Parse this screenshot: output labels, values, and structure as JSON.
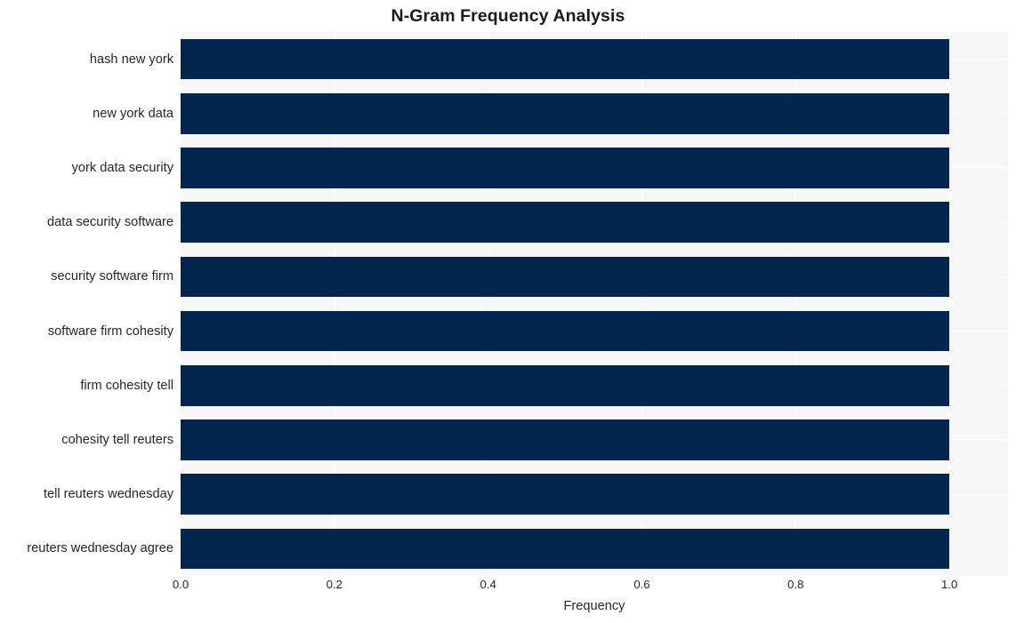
{
  "chart_data": {
    "type": "bar",
    "orientation": "horizontal",
    "title": "N-Gram Frequency Analysis",
    "xlabel": "Frequency",
    "ylabel": "",
    "categories": [
      "hash new york",
      "new york data",
      "york data security",
      "data security software",
      "security software firm",
      "software firm cohesity",
      "firm cohesity tell",
      "cohesity tell reuters",
      "tell reuters wednesday",
      "reuters wednesday agree"
    ],
    "values": [
      1.0,
      1.0,
      1.0,
      1.0,
      1.0,
      1.0,
      1.0,
      1.0,
      1.0,
      1.0
    ],
    "xlim": [
      0.0,
      1.0762
    ],
    "xticks": [
      0.0,
      0.2,
      0.4,
      0.6,
      0.8,
      1.0
    ],
    "xtick_labels": [
      "0.0",
      "0.2",
      "0.4",
      "0.6",
      "0.8",
      "1.0"
    ],
    "grid": true,
    "grid_color": "#ffffff",
    "legend": null,
    "bar_color": "#04254e",
    "plot_background": "#f7f7f7",
    "figure_background": "#ffffff",
    "text_color": "#262626"
  }
}
